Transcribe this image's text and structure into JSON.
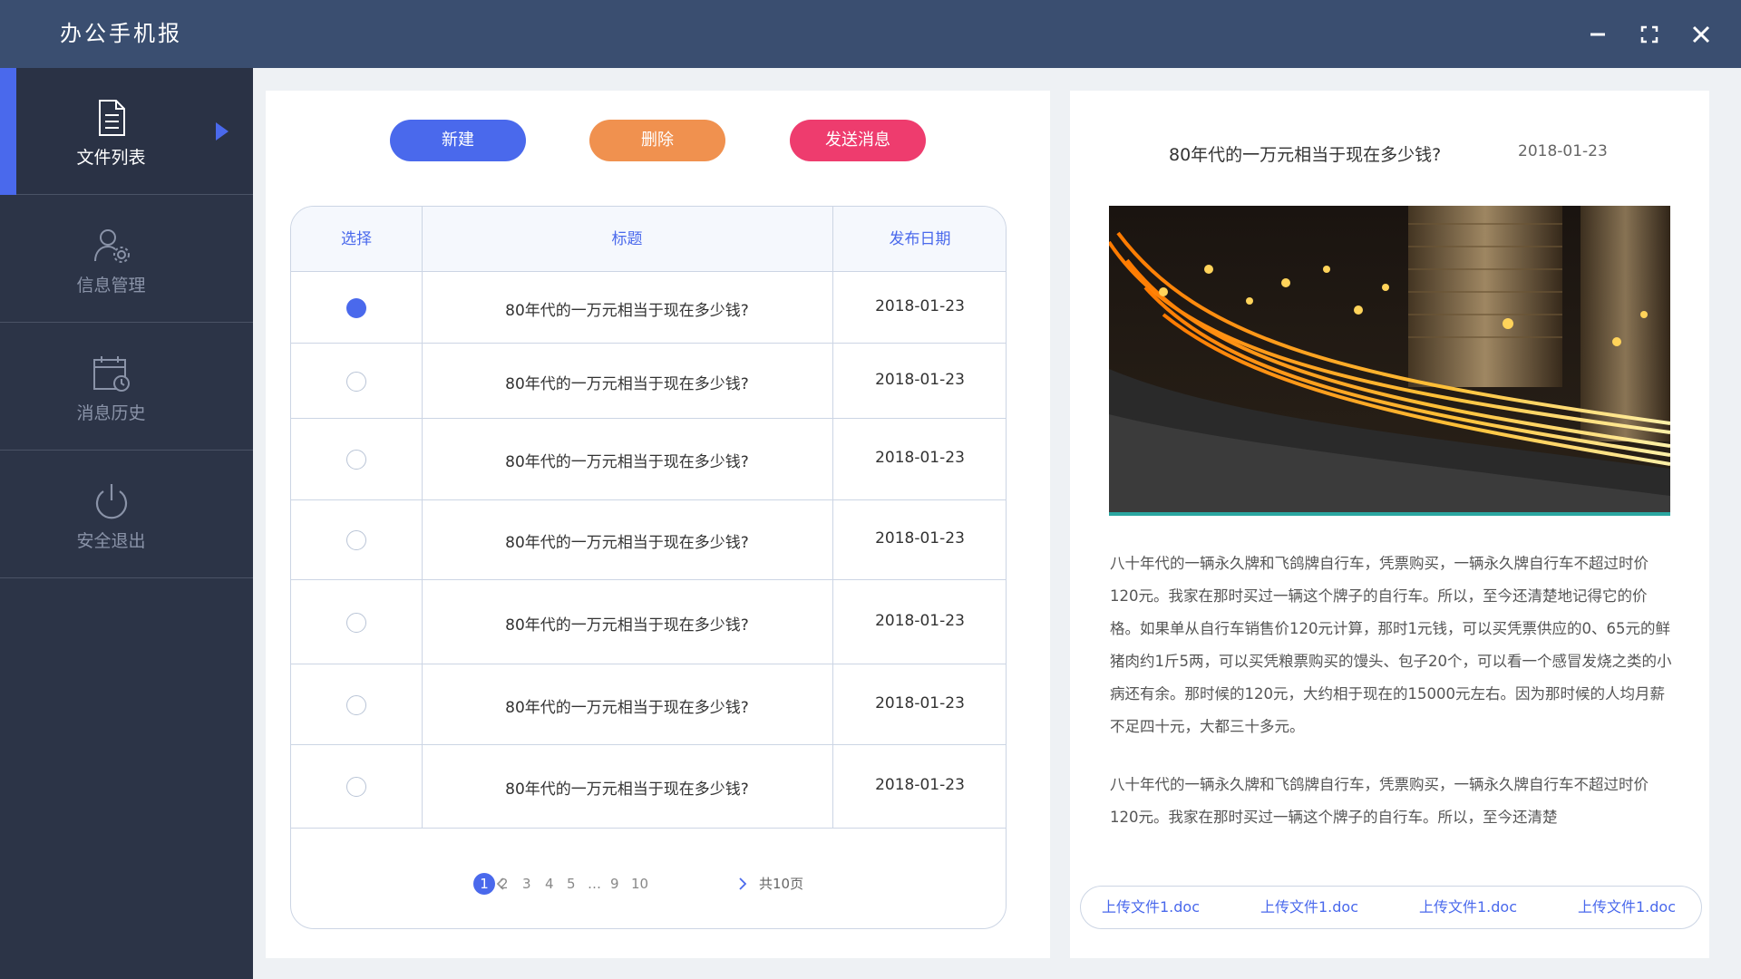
{
  "app": {
    "title": "办公手机报"
  },
  "window": {
    "minimize": "minimize-icon",
    "maximize": "maximize-icon",
    "close": "close-icon"
  },
  "sidebar": {
    "items": [
      {
        "label": "文件列表",
        "icon": "document-icon",
        "active": true
      },
      {
        "label": "信息管理",
        "icon": "user-settings-icon",
        "active": false
      },
      {
        "label": "消息历史",
        "icon": "calendar-clock-icon",
        "active": false
      },
      {
        "label": "安全退出",
        "icon": "power-icon",
        "active": false
      }
    ]
  },
  "toolbar": {
    "new_label": "新建",
    "delete_label": "删除",
    "send_label": "发送消息"
  },
  "table": {
    "headers": {
      "select": "选择",
      "title": "标题",
      "date": "发布日期"
    },
    "rows": [
      {
        "selected": true,
        "title": "80年代的一万元相当于现在多少钱?",
        "date": "2018-01-23"
      },
      {
        "selected": false,
        "title": "80年代的一万元相当于现在多少钱?",
        "date": "2018-01-23"
      },
      {
        "selected": false,
        "title": "80年代的一万元相当于现在多少钱?",
        "date": "2018-01-23"
      },
      {
        "selected": false,
        "title": "80年代的一万元相当于现在多少钱?",
        "date": "2018-01-23"
      },
      {
        "selected": false,
        "title": "80年代的一万元相当于现在多少钱?",
        "date": "2018-01-23"
      },
      {
        "selected": false,
        "title": "80年代的一万元相当于现在多少钱?",
        "date": "2018-01-23"
      },
      {
        "selected": false,
        "title": "80年代的一万元相当于现在多少钱?",
        "date": "2018-01-23"
      }
    ]
  },
  "pagination": {
    "pages": [
      "1",
      "2",
      "3",
      "4",
      "5",
      "…",
      "9",
      "10"
    ],
    "current": "1",
    "total_label": "共10页"
  },
  "article": {
    "title": "80年代的一万元相当于现在多少钱?",
    "date": "2018-01-23",
    "paragraphs": [
      "八十年代的一辆永久牌和飞鸽牌自行车，凭票购买，一辆永久牌自行车不超过时价120元。我家在那时买过一辆这个牌子的自行车。所以，至今还清楚地记得它的价格。如果单从自行车销售价120元计算，那时1元钱，可以买凭票供应的0、65元的鲜猪肉约1斤5两，可以买凭粮票购买的馒头、包子20个，可以看一个感冒发烧之类的小病还有余。那时候的120元，大约相于现在的15000元左右。因为那时候的人均月薪不足四十元，大都三十多元。",
      "八十年代的一辆永久牌和飞鸽牌自行车，凭票购买，一辆永久牌自行车不超过时价120元。我家在那时买过一辆这个牌子的自行车。所以，至今还清楚"
    ],
    "attachments": [
      "上传文件1.doc",
      "上传文件1.doc",
      "上传文件1.doc",
      "上传文件1.doc"
    ]
  },
  "colors": {
    "accent": "#4a69ec",
    "delete": "#f0914f",
    "send": "#ee3c6e",
    "titlebar": "#3a4e70",
    "sidebar": "#2c3447"
  }
}
